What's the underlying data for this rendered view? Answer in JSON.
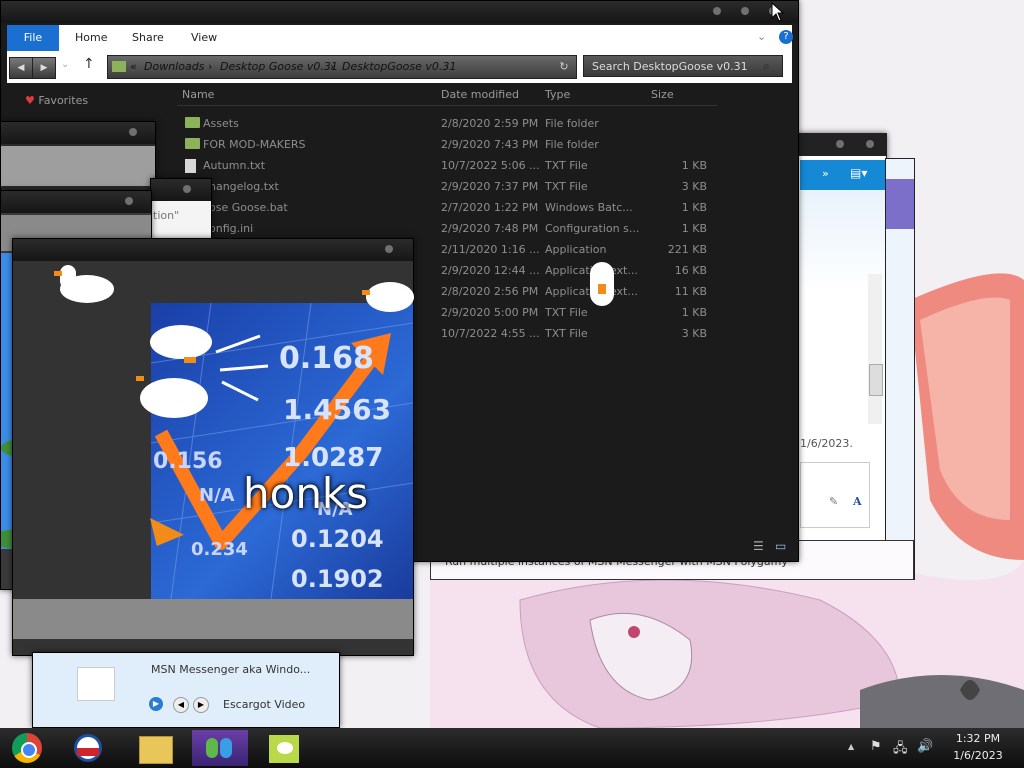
{
  "explorer": {
    "tabs": [
      "File",
      "Home",
      "Share",
      "View"
    ],
    "breadcrumb": [
      "Downloads",
      "Desktop Goose v0.31",
      "DesktopGoose v0.31"
    ],
    "breadcrumb_prefix": "«",
    "search_placeholder": "Search DesktopGoose v0.31",
    "favorites_label": "Favorites",
    "columns": {
      "name": "Name",
      "date": "Date modified",
      "type": "Type",
      "size": "Size"
    },
    "files": [
      {
        "name": "Assets",
        "date": "2/8/2020 2:59 PM",
        "type": "File folder",
        "size": "",
        "kind": "folder"
      },
      {
        "name": "FOR MOD-MAKERS",
        "date": "2/9/2020 7:43 PM",
        "type": "File folder",
        "size": "",
        "kind": "folder"
      },
      {
        "name": "Autumn.txt",
        "date": "10/7/2022 5:06 ...",
        "type": "TXT File",
        "size": "1 KB",
        "kind": "file"
      },
      {
        "name": "Changelog.txt",
        "date": "2/9/2020 7:37 PM",
        "type": "TXT File",
        "size": "3 KB",
        "kind": "file"
      },
      {
        "name": "Close Goose.bat",
        "date": "2/7/2020 1:22 PM",
        "type": "Windows Batc...",
        "size": "1 KB",
        "kind": "file"
      },
      {
        "name": "config.ini",
        "date": "2/9/2020 7:48 PM",
        "type": "Configuration s...",
        "size": "1 KB",
        "kind": "file"
      },
      {
        "name": "",
        "date": "2/11/2020 1:16 ...",
        "type": "Application",
        "size": "221 KB",
        "kind": "file"
      },
      {
        "name": "",
        "date": "2/9/2020 12:44 ...",
        "type": "Application ext...",
        "size": "16 KB",
        "kind": "file"
      },
      {
        "name": "",
        "date": "2/8/2020 2:56 PM",
        "type": "Application ext...",
        "size": "11 KB",
        "kind": "file"
      },
      {
        "name": "",
        "date": "2/9/2020 5:00 PM",
        "type": "TXT File",
        "size": "1 KB",
        "kind": "file"
      },
      {
        "name": "",
        "date": "10/7/2022 4:55 ...",
        "type": "TXT File",
        "size": "3 KB",
        "kind": "file"
      }
    ],
    "visible_names": [
      "Assets",
      "FOR MOD-MAKERS",
      "Autumn.txt",
      "hangelog.txt",
      "ose Goose.bat",
      "onfig.ini"
    ]
  },
  "notepad": {
    "text": "tion\""
  },
  "meme": {
    "caption": "honks",
    "numbers": [
      "0.168",
      "1.4563",
      "1.0287",
      "0.1204",
      "0.1902",
      "0.156",
      "0.234",
      "N/A",
      "N/A"
    ]
  },
  "messenger": {
    "date_text": "1/6/2023.",
    "footer_text": "Run multiple instances of MSN Messenger with MSN Polygamy",
    "font_label": "A"
  },
  "video_window": {
    "text_line1": "MSN Messenger aka Windo...",
    "video_label": "Escargot Video"
  },
  "taskbar": {
    "apps": [
      "Google Chrome",
      "Internet Explorer",
      "File Explorer",
      "Windows Live Messenger",
      "Desktop Goose"
    ],
    "time": "1:32 PM",
    "date": "1/6/2023",
    "tray_up": "▲"
  },
  "colors": {
    "file_tab": "#1b6fd0",
    "explorer_bg": "#1b1b1b",
    "taskbar": "#141414",
    "water": "#3a8ee6",
    "folder": "#8db25a",
    "beak": "#f28c16"
  }
}
